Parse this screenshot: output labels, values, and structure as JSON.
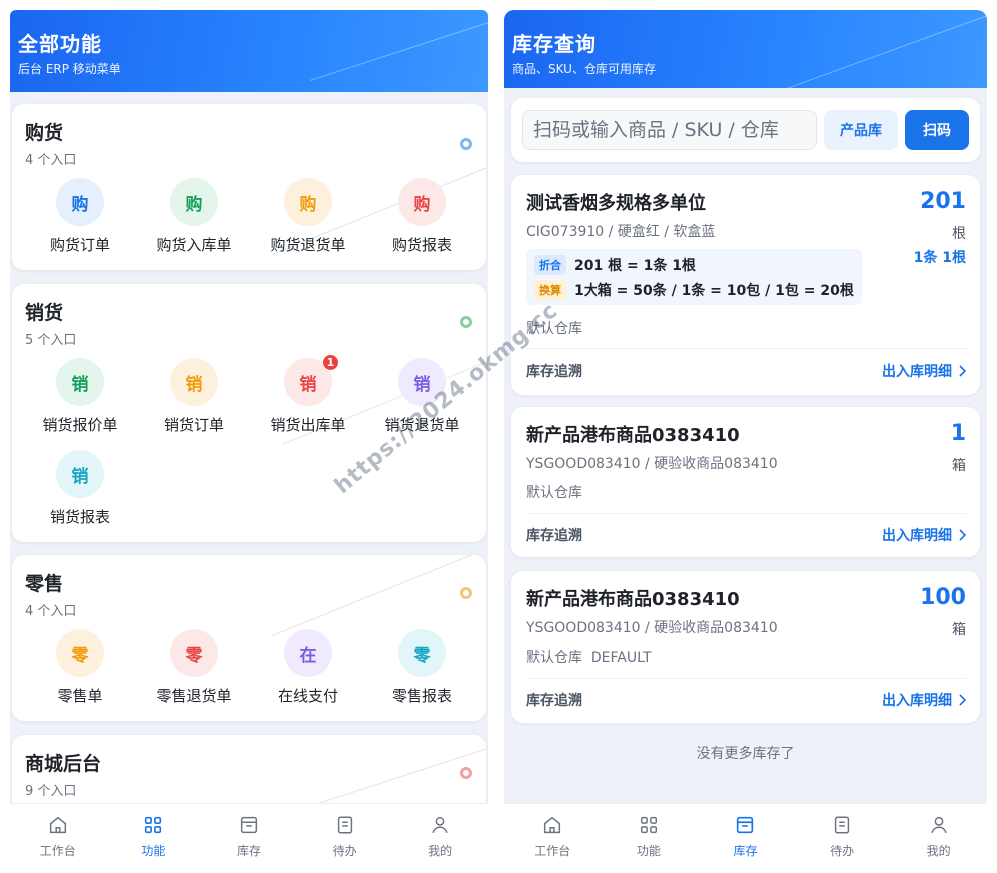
{
  "left": {
    "header": {
      "title": "全部功能",
      "subtitle": "后台 ERP 移动菜单"
    },
    "sections": [
      {
        "title": "购货",
        "count": "4 个入口",
        "accent": "#7eb6f0",
        "items": [
          {
            "glyph": "购",
            "label": "购货订单",
            "fg": "#1a73e8",
            "bg": "#e6f0fd"
          },
          {
            "glyph": "购",
            "label": "购货入库单",
            "fg": "#17a05d",
            "bg": "#e4f6ec"
          },
          {
            "glyph": "购",
            "label": "购货退货单",
            "fg": "#f29b0c",
            "bg": "#fdf1dd"
          },
          {
            "glyph": "购",
            "label": "购货报表",
            "fg": "#e84545",
            "bg": "#fde8e8"
          }
        ]
      },
      {
        "title": "销货",
        "count": "5 个入口",
        "accent": "#86cf9f",
        "items": [
          {
            "glyph": "销",
            "label": "销货报价单",
            "fg": "#17a05d",
            "bg": "#e4f6ec"
          },
          {
            "glyph": "销",
            "label": "销货订单",
            "fg": "#f29b0c",
            "bg": "#fdf1dd"
          },
          {
            "glyph": "销",
            "label": "销货出库单",
            "fg": "#e84545",
            "bg": "#fde8e8",
            "badge": "1"
          },
          {
            "glyph": "销",
            "label": "销货退货单",
            "fg": "#7c5ce0",
            "bg": "#efeafd"
          },
          {
            "glyph": "销",
            "label": "销货报表",
            "fg": "#14a6c4",
            "bg": "#e2f5f9"
          }
        ]
      },
      {
        "title": "零售",
        "count": "4 个入口",
        "accent": "#f1c47a",
        "items": [
          {
            "glyph": "零",
            "label": "零售单",
            "fg": "#f29b0c",
            "bg": "#fdf1dd"
          },
          {
            "glyph": "零",
            "label": "零售退货单",
            "fg": "#e84545",
            "bg": "#fde8e8"
          },
          {
            "glyph": "在",
            "label": "在线支付",
            "fg": "#7c5ce0",
            "bg": "#efeafd"
          },
          {
            "glyph": "零",
            "label": "零售报表",
            "fg": "#14a6c4",
            "bg": "#e2f5f9"
          }
        ]
      },
      {
        "title": "商城后台",
        "count": "9 个入口",
        "accent": "#f0a0a0",
        "items": []
      }
    ],
    "tabbar": [
      {
        "label": "工作台",
        "icon": "home-icon",
        "active": false
      },
      {
        "label": "功能",
        "icon": "grid-icon",
        "active": true
      },
      {
        "label": "库存",
        "icon": "inventory-icon",
        "active": false
      },
      {
        "label": "待办",
        "icon": "todo-icon",
        "active": false
      },
      {
        "label": "我的",
        "icon": "user-icon",
        "active": false
      }
    ]
  },
  "right": {
    "header": {
      "title": "库存查询",
      "subtitle": "商品、SKU、仓库可用库存"
    },
    "search": {
      "placeholder": "扫码或输入商品 / SKU / 仓库",
      "lib_button": "产品库",
      "scan_button": "扫码"
    },
    "items": [
      {
        "name": "测试香烟多规格多单位",
        "sku": "CIG073910 / 硬盒红 / 软盒蓝",
        "qty": "201",
        "unit": "根",
        "conv": "1条 1根",
        "tag1": "折合",
        "line1": "201 根 = 1条 1根",
        "tag2": "换算",
        "line2": "1大箱 = 50条 / 1条 = 10包 / 1包 = 20根",
        "warehouse": "默认仓库",
        "trace": "库存追溯",
        "detail": "出入库明细"
      },
      {
        "name": "新产品港布商品0383410",
        "sku": "YSGOOD083410 / 硬验收商品083410",
        "qty": "1",
        "unit": "箱",
        "warehouse": "默认仓库",
        "trace": "库存追溯",
        "detail": "出入库明细"
      },
      {
        "name": "新产品港布商品0383410",
        "sku": "YSGOOD083410 / 硬验收商品083410",
        "qty": "100",
        "unit": "箱",
        "warehouse": "默认仓库  DEFAULT",
        "trace": "库存追溯",
        "detail": "出入库明细"
      }
    ],
    "no_more": "没有更多库存了",
    "tabbar": [
      {
        "label": "工作台",
        "icon": "home-icon",
        "active": false
      },
      {
        "label": "功能",
        "icon": "grid-icon",
        "active": false
      },
      {
        "label": "库存",
        "icon": "inventory-icon",
        "active": true
      },
      {
        "label": "待办",
        "icon": "todo-icon",
        "active": false
      },
      {
        "label": "我的",
        "icon": "user-icon",
        "active": false
      }
    ]
  },
  "watermark": "https://2024.okmg.cc"
}
